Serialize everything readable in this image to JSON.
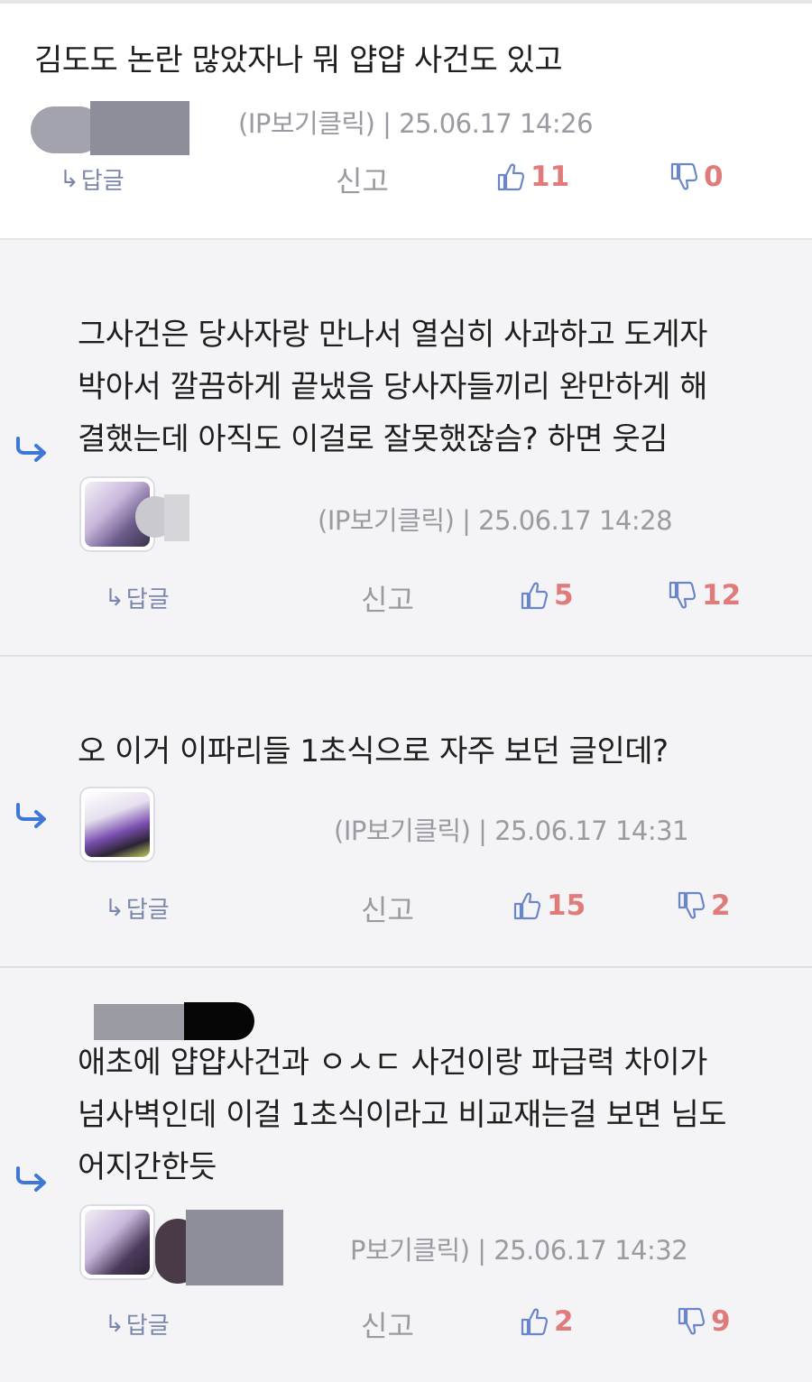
{
  "comments": [
    {
      "body": "김도도 논란 많았자나 뭐 얍얍 사건도 있고",
      "meta": "(IP보기클릭) | 25.06.17 14:26",
      "reply_label": "답글",
      "report_label": "신고",
      "likes": "11",
      "dislikes": "0"
    },
    {
      "body": "그사건은 당사자랑 만나서 열심히 사과하고 도게자\n박아서 깔끔하게 끝냈음 당사자들끼리 완만하게 해\n결했는데 아직도 이걸로 잘못했잖슴? 하면 웃김",
      "meta": "(IP보기클릭) | 25.06.17 14:28",
      "reply_label": "답글",
      "report_label": "신고",
      "likes": "5",
      "dislikes": "12"
    },
    {
      "body": "오 이거 이파리들 1초식으로 자주 보던 글인데?",
      "meta": "(IP보기클릭) | 25.06.17 14:31",
      "reply_label": "답글",
      "report_label": "신고",
      "likes": "15",
      "dislikes": "2"
    },
    {
      "body": "애초에 얍얍사건과 ㅇㅅㄷ 사건이랑 파급력 차이가\n넘사벽인데 이걸 1초식이라고 비교재는걸 보면 님도\n어지간한듯",
      "meta": "P보기클릭) | 25.06.17 14:32",
      "reply_label": "답글",
      "report_label": "신고",
      "likes": "2",
      "dislikes": "9"
    }
  ],
  "colors": {
    "reply_arrow": "#3d78d8",
    "vote_icon": "#6b86c8",
    "vote_count": "#e07b7b",
    "reply_text": "#7a86aa",
    "meta_text": "#9a9aa2"
  },
  "icons": {
    "reply": "reply-arrow-icon",
    "like": "thumbs-up-icon",
    "dislike": "thumbs-down-icon",
    "nested": "nested-reply-arrow-icon"
  }
}
